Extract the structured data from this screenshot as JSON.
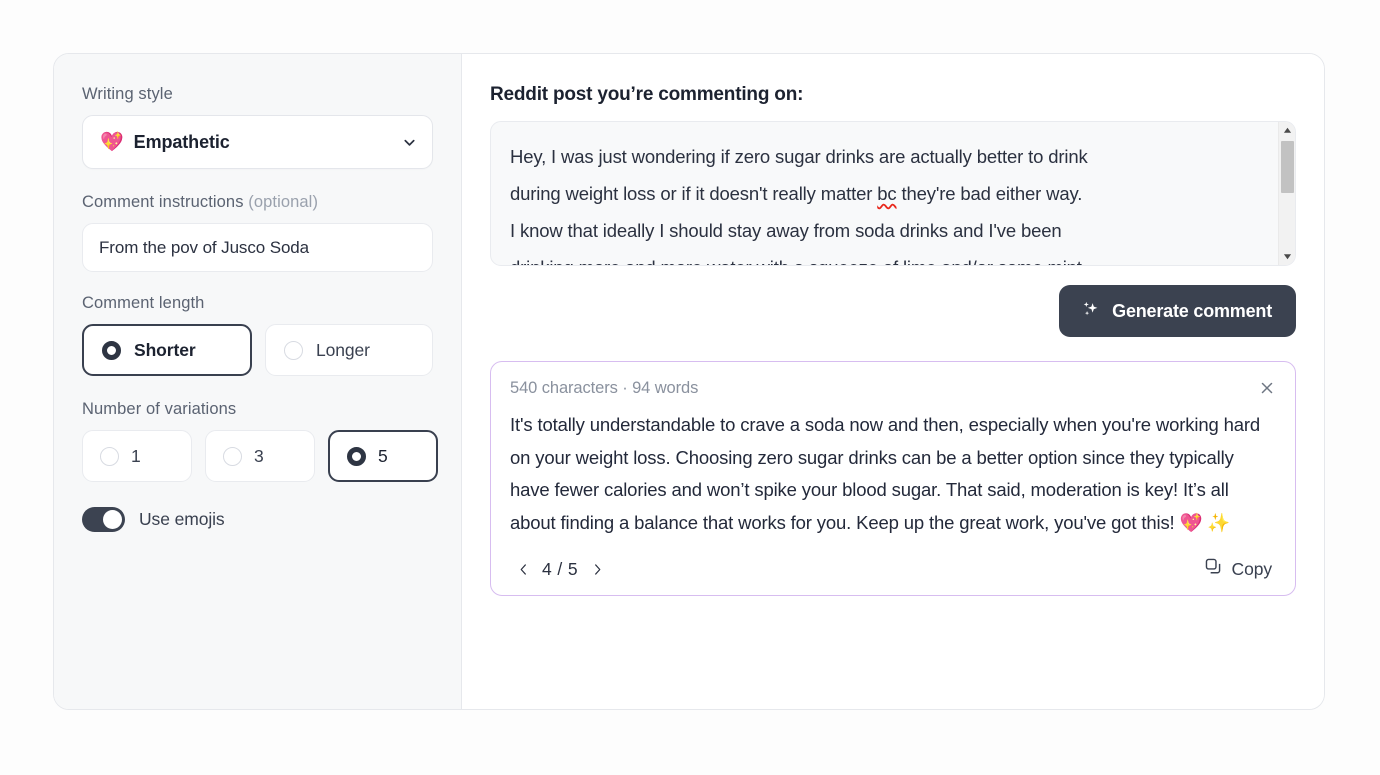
{
  "sidebar": {
    "writing_style": {
      "label": "Writing style",
      "emoji": "💖",
      "value": "Empathetic",
      "chevron_icon": "chevron-down-icon"
    },
    "instructions": {
      "label_main": "Comment instructions ",
      "label_muted": "(optional)",
      "value": "From the pov of Jusco Soda",
      "placeholder": "From the pov of Jusco Soda"
    },
    "comment_length": {
      "label": "Comment length",
      "options": [
        {
          "label": "Shorter",
          "selected": true
        },
        {
          "label": "Longer",
          "selected": false
        }
      ]
    },
    "variations": {
      "label": "Number of variations",
      "options": [
        {
          "label": "1",
          "selected": false
        },
        {
          "label": "3",
          "selected": false
        },
        {
          "label": "5",
          "selected": true
        }
      ]
    },
    "emojis_toggle": {
      "label": "Use emojis",
      "state": "on"
    }
  },
  "main": {
    "heading": "Reddit post you’re commenting on:",
    "post": {
      "line1_a": "Hey, I was just wondering if zero sugar drinks are actually better to drink",
      "line2_a": "during weight loss or if it doesn't really matter ",
      "line2_spell": "bc",
      "line2_b": " they're bad either way.",
      "line3": "I know that ideally I should stay away from soda drinks and I've been",
      "line4": "drinking more and more water with a squeeze of lime and/or some mint."
    },
    "generate_button": {
      "label": "Generate comment",
      "icon": "sparkles-icon"
    },
    "result": {
      "meta": "540 characters · 94 words",
      "close_icon": "close-icon",
      "text": "It's totally understandable to crave a soda now and then, especially when you're working hard on your weight loss. Choosing zero sugar drinks can be a better option since they typically have fewer calories and won’t spike your blood sugar. That said, moderation is key! It’s all about finding a balance that works for you. Keep up the great work, you've got this! 💖 ✨",
      "pager": {
        "prev_icon": "chevron-left-icon",
        "count": "4 / 5",
        "next_icon": "chevron-right-icon"
      },
      "copy": {
        "label": "Copy",
        "icon": "copy-icon"
      }
    }
  },
  "colors": {
    "accent_dark": "#3b4250",
    "card_border_purple": "#d7bdf0",
    "panel_bg": "#f7f8f9",
    "spellcheck_red": "#e8271b"
  }
}
